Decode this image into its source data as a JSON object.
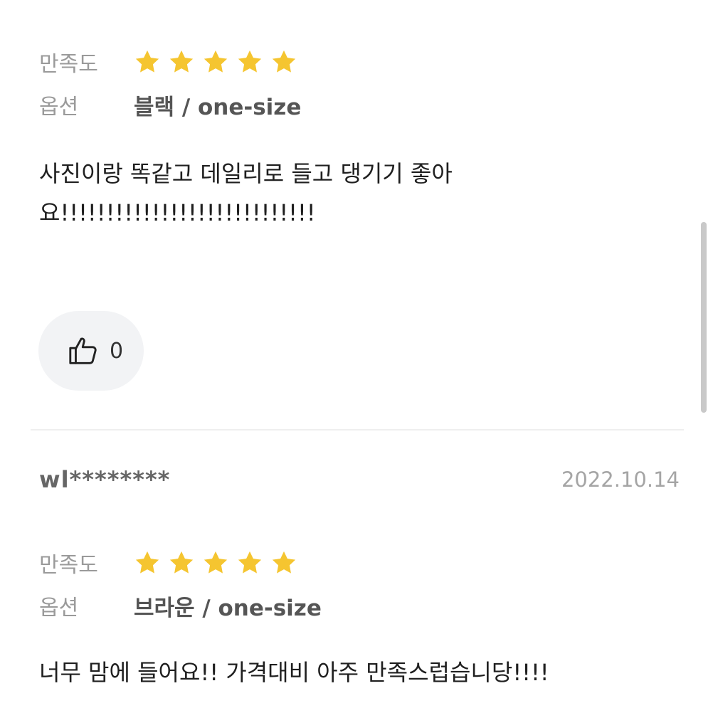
{
  "review1": {
    "satisfaction_label": "만족도",
    "rating": 5,
    "rating_max": 5,
    "option_label": "옵션",
    "option_value": "블랙 / one-size",
    "body": "사진이랑 똑같고 데일리로 들고 댕기기 좋아\n요!!!!!!!!!!!!!!!!!!!!!!!!!!!!",
    "like_icon": "thumbs-up-icon",
    "like_count": "0"
  },
  "review2": {
    "username": "wl********",
    "date": "2022.10.14",
    "satisfaction_label": "만족도",
    "rating": 5,
    "rating_max": 5,
    "option_label": "옵션",
    "option_value": "브라운 / one-size",
    "body": "너무 맘에 들어요!! 가격대비 아주 만족스럽습니당!!!!"
  },
  "colors": {
    "star": "#F5C530",
    "label": "#9A9A9A",
    "like_bg": "#F2F3F5",
    "date": "#A5A5A5"
  }
}
